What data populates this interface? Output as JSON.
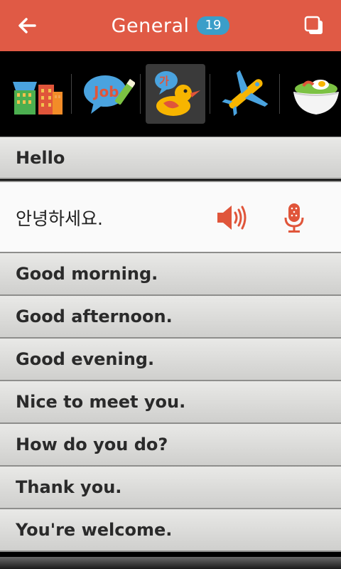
{
  "header": {
    "title": "General",
    "count": "19",
    "back_icon": "arrow-left-icon",
    "copy_icon": "copy-icon",
    "bg_color": "#e05a45",
    "badge_color": "#3b9ec9"
  },
  "categories": [
    {
      "name": "city-buildings",
      "selected": false
    },
    {
      "name": "job-speech-bubble",
      "selected": false
    },
    {
      "name": "duck-korean",
      "selected": true
    },
    {
      "name": "airplane",
      "selected": false
    },
    {
      "name": "food-bowl",
      "selected": false
    }
  ],
  "phrases": {
    "p0": "Hello",
    "p0_korean": "안녕하세요.",
    "p1": "Good morning.",
    "p2": "Good afternoon.",
    "p3": "Good evening.",
    "p4": "Nice to meet you.",
    "p5": "How do you do?",
    "p6": "Thank you.",
    "p7": "You're welcome."
  },
  "icons": {
    "speaker": "speaker-icon",
    "mic": "microphone-icon",
    "accent": "#e0553a"
  },
  "duck_badge_text": "가",
  "job_text": "Job"
}
